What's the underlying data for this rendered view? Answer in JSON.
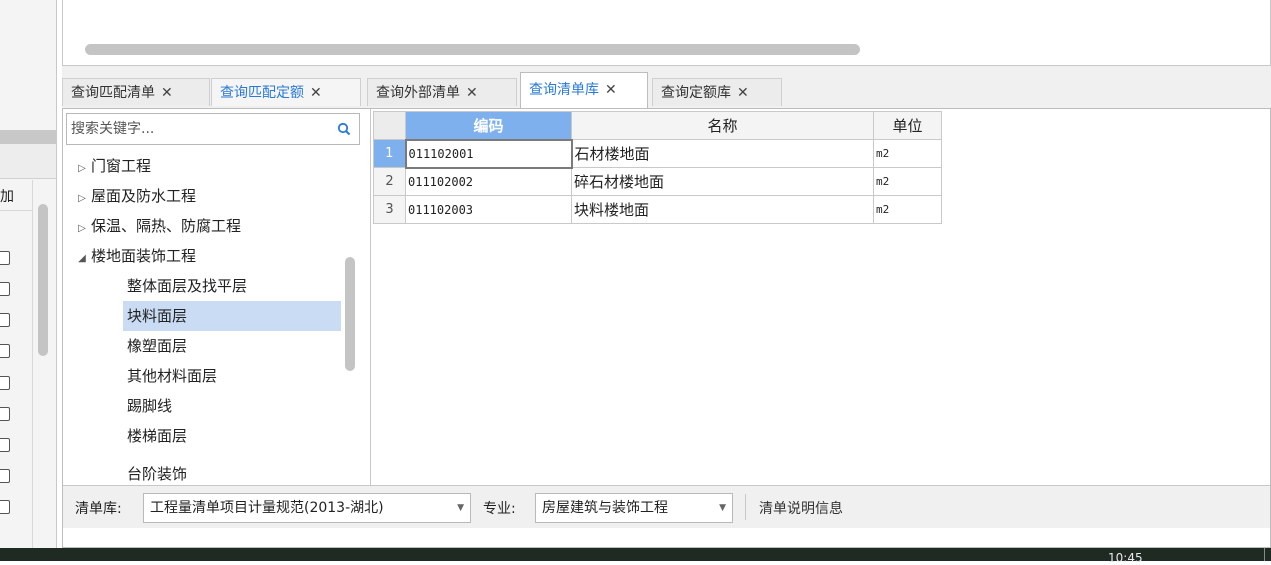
{
  "left_strip": {
    "column_label": "加"
  },
  "tabs": [
    {
      "label": "查询匹配清单",
      "close": "✕"
    },
    {
      "label": "查询匹配定额",
      "close": "✕"
    },
    {
      "label": "查询外部清单",
      "close": "✕"
    },
    {
      "label": "查询清单库",
      "close": "✕"
    },
    {
      "label": "查询定额库",
      "close": "✕"
    }
  ],
  "search": {
    "placeholder": "搜索关键字..."
  },
  "tree": {
    "top_items": [
      "门窗工程",
      "屋面及防水工程",
      "保温、隔热、防腐工程",
      "楼地面装饰工程"
    ],
    "children": [
      "整体面层及找平层",
      "块料面层",
      "橡塑面层",
      "其他材料面层",
      "踢脚线",
      "楼梯面层",
      "台阶装饰"
    ]
  },
  "grid": {
    "headers": {
      "code": "编码",
      "name": "名称",
      "unit": "单位"
    },
    "rows": [
      {
        "num": "1",
        "code": "011102001",
        "name": "石材楼地面",
        "unit": "m2"
      },
      {
        "num": "2",
        "code": "011102002",
        "name": "碎石材楼地面",
        "unit": "m2"
      },
      {
        "num": "3",
        "code": "011102003",
        "name": "块料楼地面",
        "unit": "m2"
      }
    ]
  },
  "footer": {
    "library_label": "清单库:",
    "library_value": "工程量清单项目计量规范(2013-湖北)",
    "specialty_label": "专业:",
    "specialty_value": "房屋建筑与装饰工程",
    "info_link": "清单说明信息"
  },
  "taskbar": {
    "clock": "10:45"
  },
  "colors": {
    "accent": "#2a7ad6",
    "header_highlight": "#7db0ec",
    "selection": "#c9dcf3"
  }
}
